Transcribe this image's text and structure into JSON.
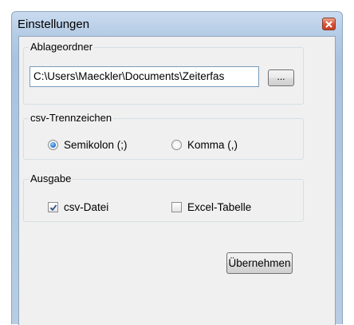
{
  "window": {
    "title": "Einstellungen",
    "close_icon": "close-icon"
  },
  "storage": {
    "group_label": "Ablageordner",
    "path_value": "C:\\Users\\Maeckler\\Documents\\Zeiterfas",
    "browse_label": "..."
  },
  "separator": {
    "group_label": "csv-Trennzeichen",
    "options": [
      {
        "label": "Semikolon (;)",
        "selected": true
      },
      {
        "label": "Komma (,)",
        "selected": false
      }
    ]
  },
  "output": {
    "group_label": "Ausgabe",
    "options": [
      {
        "label": "csv-Datei",
        "checked": true
      },
      {
        "label": "Excel-Tabelle",
        "checked": false
      }
    ]
  },
  "actions": {
    "apply_label": "Übernehmen"
  },
  "colors": {
    "accent": "#2a7bd8",
    "close_red": "#c43d20",
    "frame": "#aac3df"
  }
}
